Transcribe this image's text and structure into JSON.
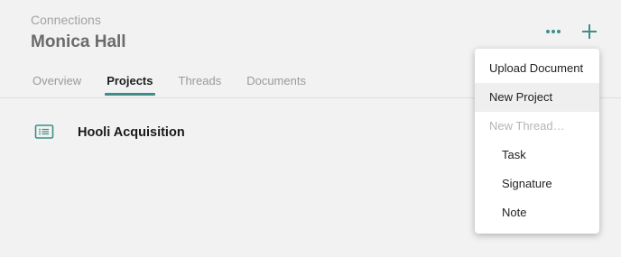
{
  "header": {
    "breadcrumb": "Connections",
    "title": "Monica Hall",
    "more_icon": "more-horizontal-icon",
    "add_icon": "plus-icon"
  },
  "tabs": [
    {
      "label": "Overview",
      "active": false
    },
    {
      "label": "Projects",
      "active": true
    },
    {
      "label": "Threads",
      "active": false
    },
    {
      "label": "Documents",
      "active": false
    }
  ],
  "projects": [
    {
      "name": "Hooli Acquisition",
      "icon": "project-list-icon"
    }
  ],
  "menu": {
    "items": [
      {
        "label": "Upload Document"
      },
      {
        "label": "New Project"
      },
      {
        "label": "New Thread…"
      },
      {
        "label": "Task"
      },
      {
        "label": "Signature"
      },
      {
        "label": "Note"
      }
    ]
  },
  "colors": {
    "accent": "#3d8e88",
    "background": "#f2f2f2",
    "menu_background": "#ffffff"
  }
}
